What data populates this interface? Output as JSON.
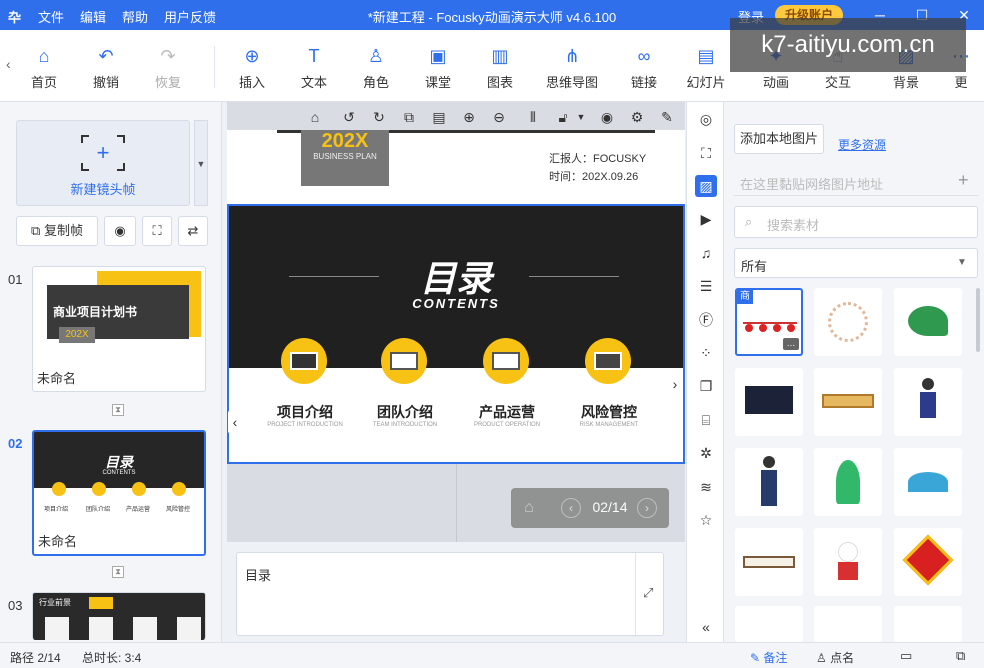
{
  "titlebar": {
    "logo": "卆",
    "menus": [
      "文件",
      "编辑",
      "帮助",
      "用户反馈"
    ],
    "title": "*新建工程 - Focusky动画演示大师  v4.6.100",
    "login": "登录",
    "upgrade": "升级账户",
    "accent": "#2f6fec"
  },
  "toolbar": {
    "items": [
      {
        "label": "首页",
        "icon": "home-icon"
      },
      {
        "label": "撤销",
        "icon": "undo-icon"
      },
      {
        "label": "恢复",
        "icon": "redo-icon"
      },
      {
        "label": "插入",
        "icon": "plus-circle-icon"
      },
      {
        "label": "文本",
        "icon": "text-icon"
      },
      {
        "label": "角色",
        "icon": "person-icon"
      },
      {
        "label": "课堂",
        "icon": "classroom-icon"
      },
      {
        "label": "图表",
        "icon": "chart-icon"
      },
      {
        "label": "思维导图",
        "icon": "mindmap-icon"
      },
      {
        "label": "链接",
        "icon": "link-icon"
      },
      {
        "label": "幻灯片",
        "icon": "slides-icon"
      },
      {
        "label": "动画",
        "icon": "animation-icon"
      },
      {
        "label": "交互",
        "icon": "interaction-icon"
      },
      {
        "label": "背景",
        "icon": "background-icon"
      },
      {
        "label": "更",
        "icon": "more-icon"
      }
    ]
  },
  "watermark": "k7-aitiyu.com.cn",
  "left": {
    "new_frame": "新建镜头帧",
    "copy_frame": "复制帧",
    "frames": [
      {
        "num": "01",
        "name": "未命名",
        "title": "商业项目计划书",
        "sub": "202X"
      },
      {
        "num": "02",
        "name": "未命名",
        "title": "目录",
        "sub": "CONTENTS",
        "items": [
          "项目介绍",
          "团队介绍",
          "产品运营",
          "风险管控"
        ]
      },
      {
        "num": "03",
        "name": "",
        "title": "行业前景",
        "items": [
          "",
          "",
          "",
          ""
        ]
      }
    ]
  },
  "canvas": {
    "top_slide": {
      "badge": "202X",
      "badge_sub": "BUSINESS PLAN",
      "reporter": "汇报人：FOCUSKY",
      "date": "时间：202X.09.26"
    },
    "slide": {
      "title": "目录",
      "subtitle": "CONTENTS",
      "items": [
        {
          "label": "项目介绍",
          "en": "PROJECT INTRODUCTION"
        },
        {
          "label": "团队介绍",
          "en": "TEAM INTRODUCTION"
        },
        {
          "label": "产品运营",
          "en": "PRODUCT OPERATION"
        },
        {
          "label": "风险管控",
          "en": "RISK MANAGEMENT"
        }
      ]
    },
    "pager": "02/14",
    "notes": "目录"
  },
  "right": {
    "add_local": "添加本地图片",
    "more_resources": "更多资源",
    "url_placeholder": "在这里黏贴网络图片地址",
    "search_placeholder": "搜索素材",
    "category": "所有",
    "tag": "商"
  },
  "status": {
    "path": "路径 2/14",
    "duration": "总时长: 3:4",
    "notes": "备注",
    "rollcall": "点名"
  }
}
